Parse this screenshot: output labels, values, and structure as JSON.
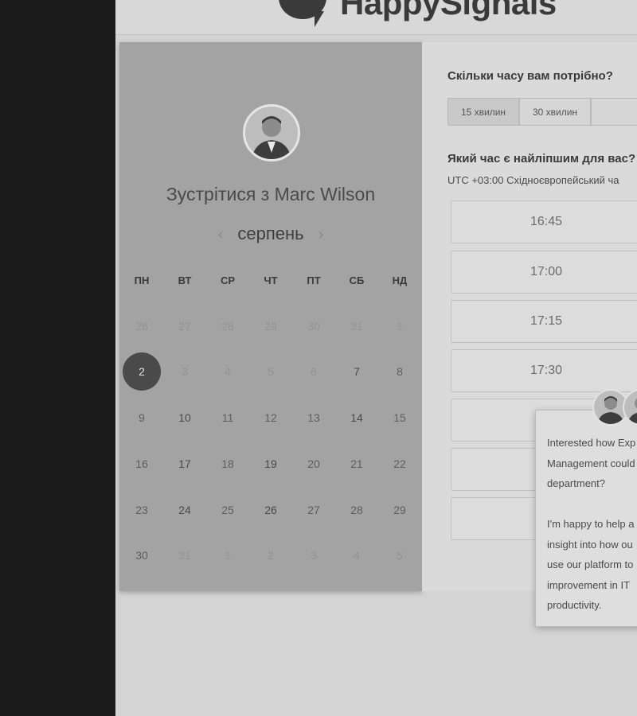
{
  "header": {
    "logo_text": "HappySignals"
  },
  "calendar": {
    "title": "Зустрітися з Marc Wilson",
    "month": "серпень",
    "prev_arrow": "‹",
    "next_arrow": "›",
    "weekdays": [
      "ПН",
      "ВТ",
      "СР",
      "ЧТ",
      "ПТ",
      "СБ",
      "НД"
    ],
    "weeks": [
      [
        "26",
        "27",
        "28",
        "29",
        "30",
        "31",
        "1"
      ],
      [
        "2",
        "3",
        "4",
        "5",
        "6",
        "7",
        "8"
      ],
      [
        "9",
        "10",
        "11",
        "12",
        "13",
        "14",
        "15"
      ],
      [
        "16",
        "17",
        "18",
        "19",
        "20",
        "21",
        "22"
      ],
      [
        "23",
        "24",
        "25",
        "26",
        "27",
        "28",
        "29"
      ],
      [
        "30",
        "31",
        "1",
        "2",
        "3",
        "4",
        "5"
      ]
    ],
    "selected_day": "2"
  },
  "scheduler": {
    "duration_question": "Скільки часу вам потрібно?",
    "durations": [
      "15 хвилин",
      "30 хвилин",
      ""
    ],
    "time_question": "Який час є найліпшим для вас?",
    "timezone": "UTC +03:00 Східноєвропейський ча",
    "slots": [
      "16:45",
      "17:00",
      "17:15",
      "17:30",
      "",
      "",
      ""
    ]
  },
  "chat": {
    "message": "Interested how Exp\nManagement could\ndepartment?\n\nI'm happy to help a\ninsight into how ou\nuse our platform to\nimprovement in IT\nproductivity."
  },
  "colors": {
    "selected_day": "#4a4a4a",
    "calendar_bg": "#a3a3a3",
    "sidebar_bg": "#1b1b1b"
  }
}
